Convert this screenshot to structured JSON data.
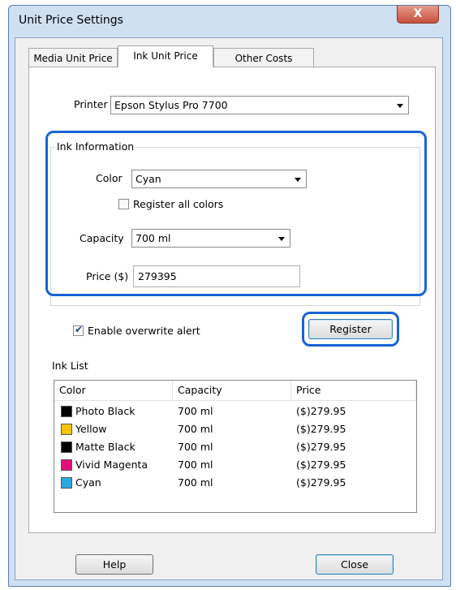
{
  "window": {
    "title": "Unit Price Settings",
    "close_glyph": "X"
  },
  "tabs": [
    {
      "label": "Media Unit Price"
    },
    {
      "label": "Ink Unit Price"
    },
    {
      "label": "Other Costs"
    }
  ],
  "active_tab": "Ink Unit Price",
  "printer": {
    "label": "Printer",
    "value": "Epson Stylus Pro 7700"
  },
  "ink_info": {
    "title": "Ink Information",
    "color_label": "Color",
    "color_value": "Cyan",
    "register_all_label": "Register all colors",
    "register_all_checked": false,
    "capacity_label": "Capacity",
    "capacity_value": "700 ml",
    "price_label": "Price ($)",
    "price_value": "279395"
  },
  "overwrite_alert": {
    "label": "Enable overwrite alert",
    "checked": true
  },
  "register_button": "Register",
  "ink_list": {
    "title": "Ink List",
    "columns": [
      "Color",
      "Capacity",
      "Price"
    ],
    "rows": [
      {
        "color": "Photo Black",
        "swatch": "#000000",
        "capacity": "700 ml",
        "price": "($)279.95"
      },
      {
        "color": "Yellow",
        "swatch": "#f5c400",
        "capacity": "700 ml",
        "price": "($)279.95"
      },
      {
        "color": "Matte Black",
        "swatch": "#000000",
        "capacity": "700 ml",
        "price": "($)279.95"
      },
      {
        "color": "Vivid Magenta",
        "swatch": "#e0107a",
        "capacity": "700 ml",
        "price": "($)279.95"
      },
      {
        "color": "Cyan",
        "swatch": "#29a8e0",
        "capacity": "700 ml",
        "price": "($)279.95"
      }
    ]
  },
  "footer": {
    "help": "Help",
    "close": "Close"
  },
  "colors": {
    "highlight": "#1863d6",
    "window_frame": "#cfe0f2"
  }
}
